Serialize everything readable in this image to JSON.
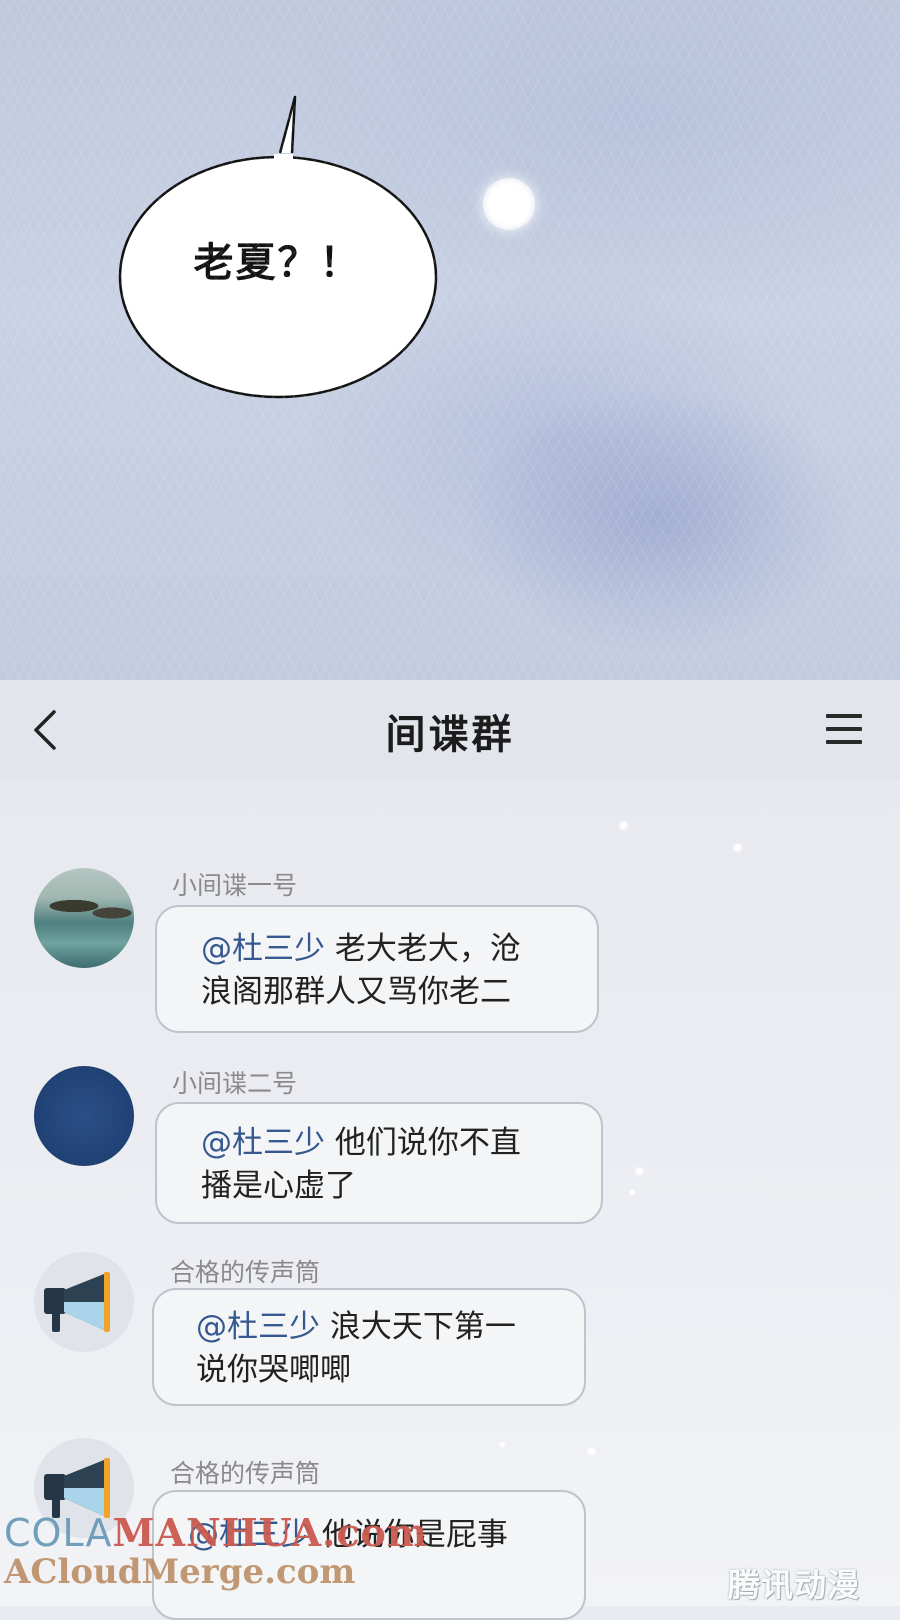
{
  "comic": {
    "speech_bubble": "老夏？！"
  },
  "chat": {
    "title": "间谍群",
    "messages": [
      {
        "sender": "小间谍一号",
        "mention": "@杜三少",
        "line1_rest": " 老大老大，沧",
        "line2": "浪阁那群人又骂你老二",
        "avatar_icon": "landscape-avatar-icon"
      },
      {
        "sender": "小间谍二号",
        "mention": "@杜三少",
        "line1_rest": " 他们说你不直",
        "line2": "播是心虚了",
        "avatar_icon": "blue-avatar-icon"
      },
      {
        "sender": "合格的传声筒",
        "mention": "@杜三少",
        "line1_rest": " 浪大天下第一",
        "line2": "说你哭唧唧",
        "avatar_icon": "megaphone-icon"
      },
      {
        "sender": "合格的传声筒",
        "mention": "@杜三少",
        "line1_rest": " 他说你是屁事",
        "avatar_icon": "megaphone-icon"
      }
    ]
  },
  "watermarks": {
    "manhua_prefix": "COLA",
    "manhua": "MANHUA.com",
    "acloud": "ACloudMerge.com",
    "tencent": "腾讯动漫"
  },
  "colors": {
    "mention": "#35588f",
    "nickname": "#8a8a8a",
    "bubble_border": "#bfc3cd"
  }
}
